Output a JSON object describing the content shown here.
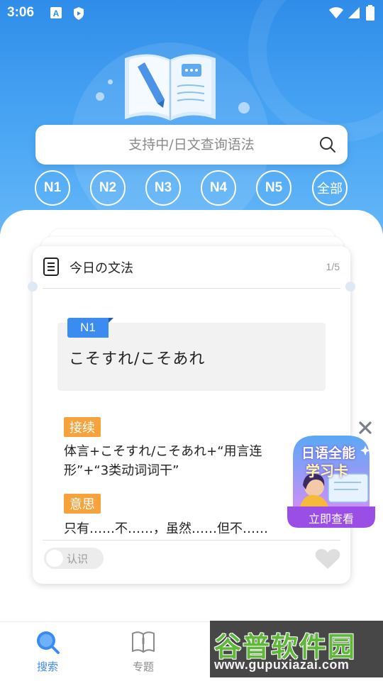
{
  "status_bar": {
    "time": "3:06"
  },
  "search": {
    "placeholder": "支持中/日文查询语法"
  },
  "levels": [
    "N1",
    "N2",
    "N3",
    "N4",
    "N5",
    "全部"
  ],
  "card": {
    "title": "今日の文法",
    "page": "1/5",
    "level_tag": "N1",
    "grammar": "こそすれ/こそあれ",
    "connection_label": "接续",
    "connection_lines": [
      "体言+こそすれ/こそあれ+“用言连",
      "形”+“3类动词词干”"
    ],
    "meaning_label": "意思",
    "meaning": "只有……不……，虽然……但不……",
    "known_toggle": "认识"
  },
  "promo": {
    "title_line1": "日语全能",
    "title_line2": "学习卡",
    "button": "立即查看"
  },
  "tabs": [
    {
      "label": "搜索",
      "active": true
    },
    {
      "label": "专题",
      "active": false
    }
  ],
  "watermark": {
    "line1": "谷普软件园",
    "line2": "www.gupuxiazai.com"
  },
  "colors": {
    "primary": "#3b8cf0",
    "accent_orange": "#f7a23a",
    "hero_blue": "#2f8de9",
    "promo_purple": "#8b4fe0"
  }
}
